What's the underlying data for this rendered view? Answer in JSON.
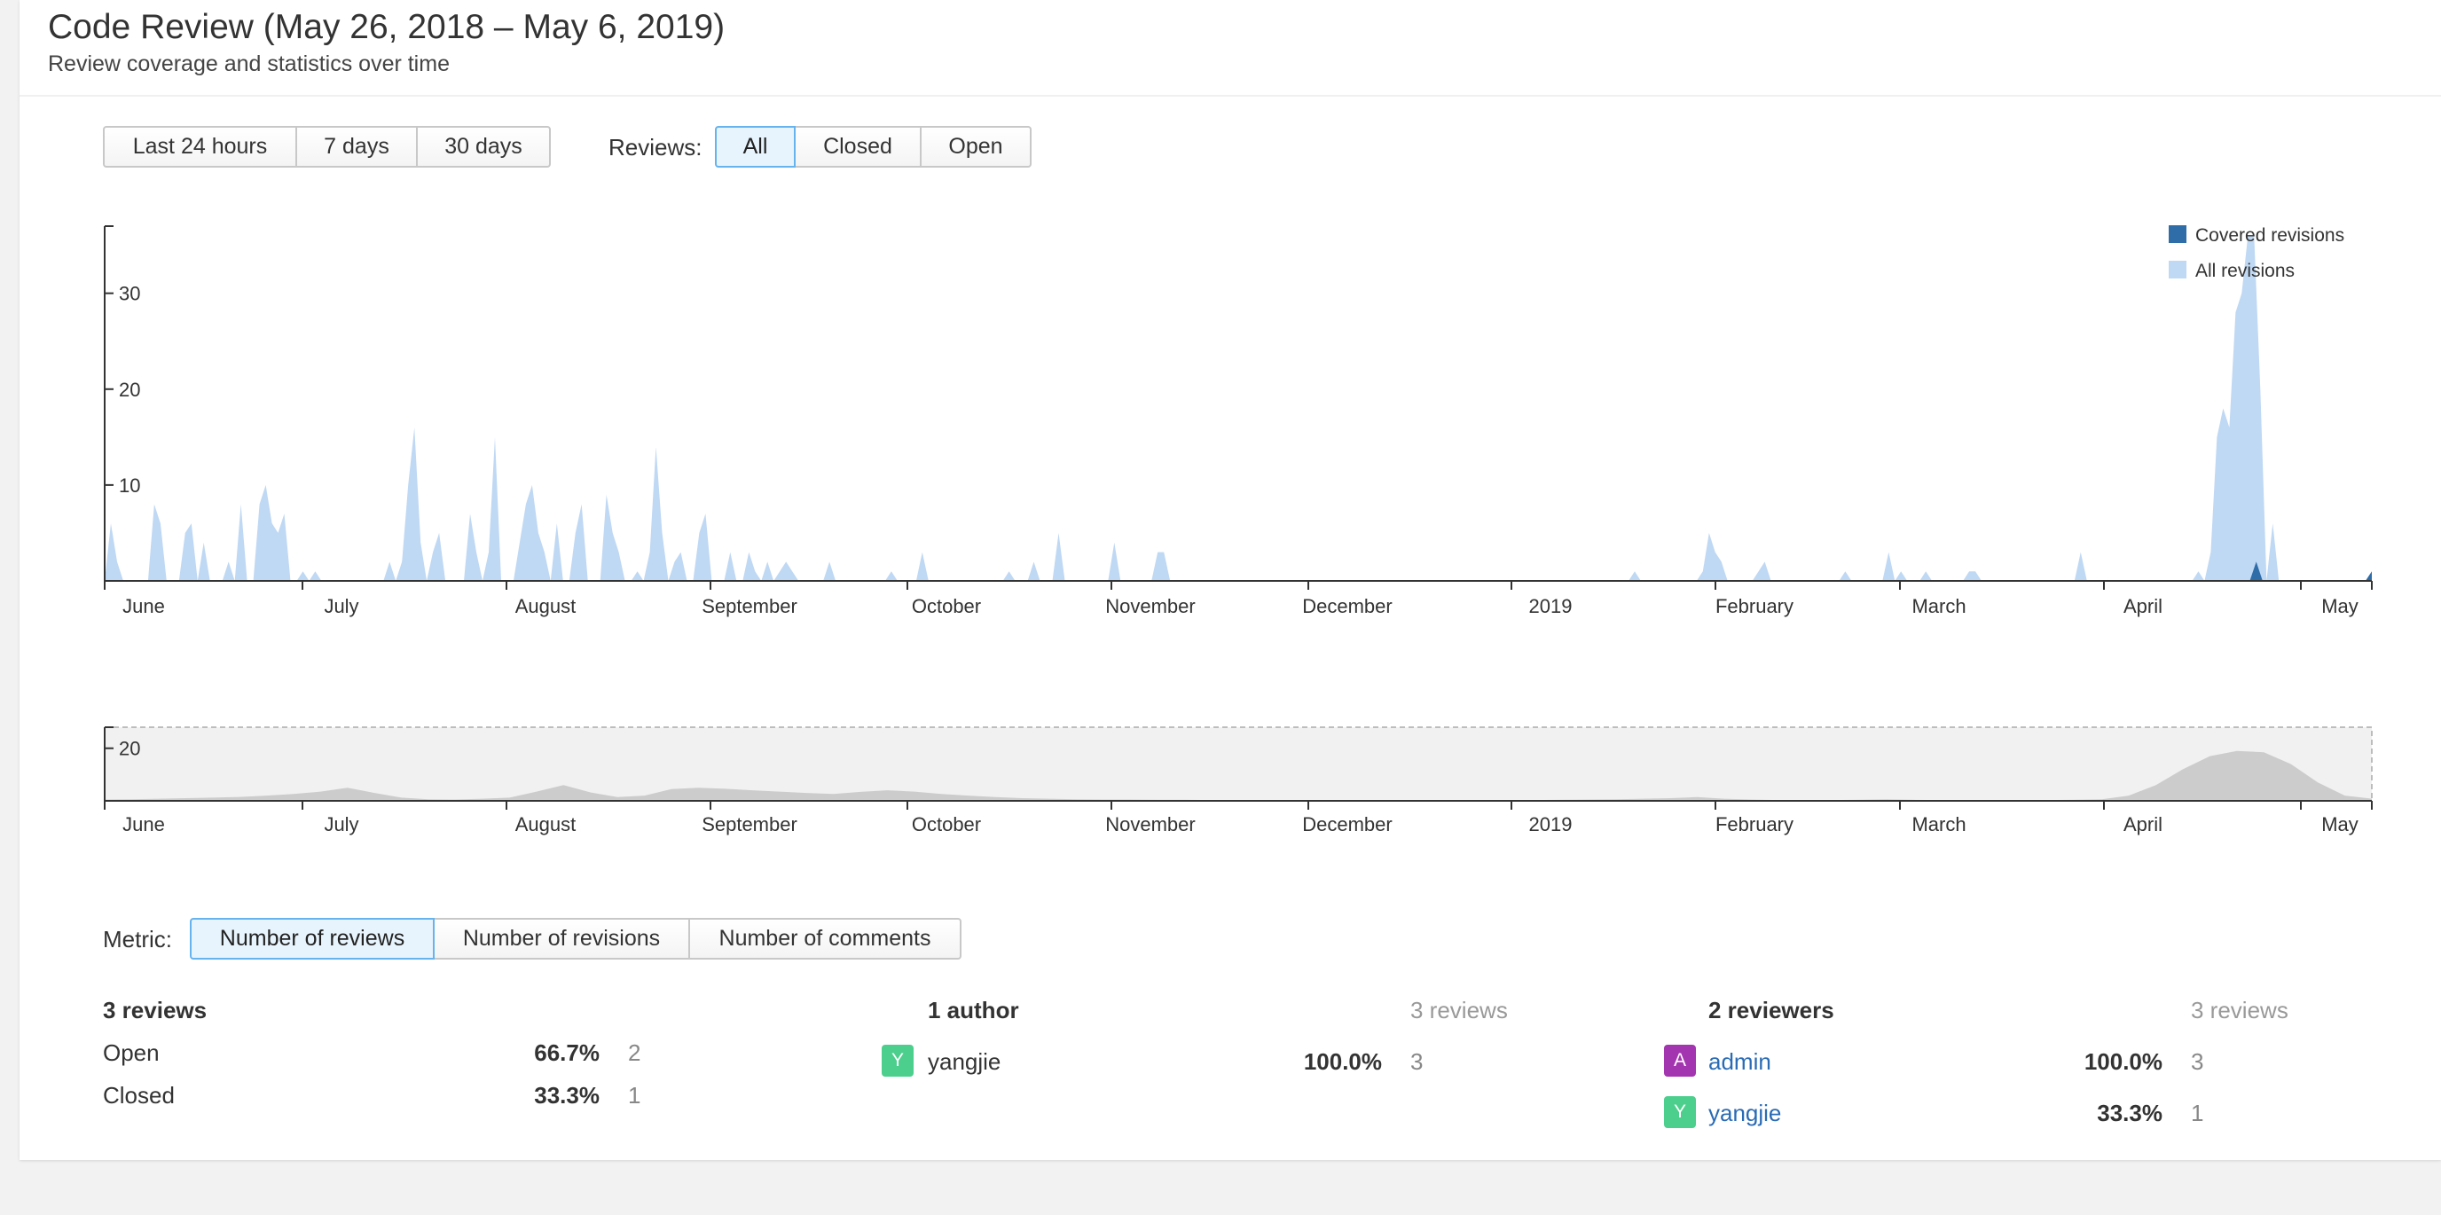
{
  "page": {
    "title": "Code Review (May 26, 2018 – May 6, 2019)",
    "subtitle": "Review coverage and statistics over time"
  },
  "range_buttons": [
    "Last 24 hours",
    "7 days",
    "30 days"
  ],
  "reviews_filter": {
    "label": "Reviews:",
    "options": [
      "All",
      "Closed",
      "Open"
    ],
    "selected": "All"
  },
  "metric": {
    "label": "Metric:",
    "options": [
      "Number of reviews",
      "Number of revisions",
      "Number of comments"
    ],
    "selected": "Number of reviews"
  },
  "colors": {
    "covered": "#2f6da8",
    "all": "#bfd8f3",
    "overview": "#cccccc",
    "avatar_a": "#a335b0",
    "avatar_y": "#4ccf8d"
  },
  "chart_data": [
    {
      "type": "area",
      "legend": [
        "Covered revisions",
        "All revisions"
      ],
      "legend_position": "top-right",
      "x_ticks": [
        "June",
        "July",
        "August",
        "September",
        "October",
        "November",
        "December",
        "2019",
        "February",
        "March",
        "April",
        "May"
      ],
      "y_ticks": [
        10,
        20,
        30
      ],
      "ylim": [
        0,
        37
      ],
      "series": [
        {
          "name": "All revisions",
          "values": [
            0,
            6,
            2,
            0,
            0,
            0,
            0,
            0,
            8,
            6,
            0,
            0,
            0,
            5,
            6,
            0,
            4,
            0,
            0,
            0,
            2,
            0,
            8,
            0,
            0,
            8,
            10,
            6,
            5,
            7,
            0,
            0,
            1,
            0,
            1,
            0,
            0,
            0,
            0,
            0,
            0,
            0,
            0,
            0,
            0,
            0,
            2,
            0,
            2,
            10,
            16,
            4,
            0,
            3,
            5,
            0,
            0,
            0,
            0,
            7,
            3,
            0,
            3,
            15,
            0,
            0,
            0,
            4,
            8,
            10,
            5,
            3,
            0,
            6,
            0,
            0,
            5,
            8,
            0,
            0,
            0,
            9,
            5,
            3,
            0,
            0,
            1,
            0,
            3,
            14,
            5,
            0,
            2,
            3,
            0,
            0,
            5,
            7,
            0,
            0,
            0,
            3,
            0,
            0,
            3,
            1,
            0,
            2,
            0,
            1,
            2,
            1,
            0,
            0,
            0,
            0,
            0,
            2,
            0,
            0,
            0,
            0,
            0,
            0,
            0,
            0,
            0,
            1,
            0,
            0,
            0,
            0,
            3,
            0,
            0,
            0,
            0,
            0,
            0,
            0,
            0,
            0,
            0,
            0,
            0,
            0,
            1,
            0,
            0,
            0,
            2,
            0,
            0,
            0,
            5,
            0,
            0,
            0,
            0,
            0,
            0,
            0,
            0,
            4,
            0,
            0,
            0,
            0,
            0,
            0,
            3,
            3,
            0,
            0,
            0,
            0,
            0,
            0,
            0,
            0,
            0,
            0,
            0,
            0,
            0,
            0,
            0,
            0,
            0,
            0,
            0,
            0,
            0,
            0,
            0,
            0,
            0,
            0,
            0,
            0,
            0,
            0,
            0,
            0,
            0,
            0,
            0,
            0,
            0,
            0,
            0,
            0,
            0,
            0,
            0,
            0,
            0,
            0,
            0,
            0,
            0,
            0,
            0,
            0,
            0,
            0,
            0,
            0,
            0,
            0,
            0,
            0,
            0,
            0,
            0,
            0,
            0,
            0,
            0,
            0,
            0,
            0,
            0,
            0,
            0,
            0,
            0,
            1,
            0,
            0,
            0,
            0,
            0,
            0,
            0,
            0,
            0,
            0,
            1,
            5,
            3,
            2,
            0,
            0,
            0,
            0,
            0,
            1,
            2,
            0,
            0,
            0,
            0,
            0,
            0,
            0,
            0,
            0,
            0,
            0,
            0,
            1,
            0,
            0,
            0,
            0,
            0,
            0,
            3,
            0,
            1,
            0,
            0,
            0,
            1,
            0,
            0,
            0,
            0,
            0,
            0,
            1,
            1,
            0,
            0,
            0,
            0,
            0,
            0,
            0,
            0,
            0,
            0,
            0,
            0,
            0,
            0,
            0,
            0,
            3,
            0,
            0,
            0,
            0,
            0,
            0,
            0,
            0,
            0,
            0,
            0,
            0,
            0,
            0,
            0,
            0,
            0,
            0,
            1,
            0,
            3,
            15,
            18,
            16,
            28,
            30,
            36,
            36,
            20,
            0,
            6,
            0,
            0,
            0,
            0,
            0,
            0,
            0,
            0,
            0,
            0,
            0,
            0,
            0,
            0,
            0,
            1
          ],
          "color": "#bfd8f3"
        },
        {
          "name": "Covered revisions",
          "values": [
            0,
            0,
            0,
            0,
            0,
            0,
            0,
            0,
            0,
            0,
            0,
            0,
            0,
            0,
            0,
            0,
            0,
            0,
            0,
            0,
            0,
            0,
            0,
            0,
            0,
            0,
            0,
            0,
            0,
            0,
            0,
            0,
            0,
            0,
            0,
            0,
            0,
            0,
            0,
            0,
            0,
            0,
            0,
            0,
            0,
            0,
            0,
            0,
            0,
            0,
            0,
            0,
            0,
            0,
            0,
            0,
            0,
            0,
            0,
            0,
            0,
            0,
            0,
            0,
            0,
            0,
            0,
            0,
            0,
            0,
            0,
            0,
            0,
            0,
            0,
            0,
            0,
            0,
            0,
            0,
            0,
            0,
            0,
            0,
            0,
            0,
            0,
            0,
            0,
            0,
            0,
            0,
            0,
            0,
            0,
            0,
            0,
            0,
            0,
            0,
            0,
            0,
            0,
            0,
            0,
            0,
            0,
            0,
            0,
            0,
            0,
            0,
            0,
            0,
            0,
            0,
            0,
            0,
            0,
            0,
            0,
            0,
            0,
            0,
            0,
            0,
            0,
            0,
            0,
            0,
            0,
            0,
            0,
            0,
            0,
            0,
            0,
            0,
            0,
            0,
            0,
            0,
            0,
            0,
            0,
            0,
            0,
            0,
            0,
            0,
            0,
            0,
            0,
            0,
            0,
            0,
            0,
            0,
            0,
            0,
            0,
            0,
            0,
            0,
            0,
            0,
            0,
            0,
            0,
            0,
            0,
            0,
            0,
            0,
            0,
            0,
            0,
            0,
            0,
            0,
            0,
            0,
            0,
            0,
            0,
            0,
            0,
            0,
            0,
            0,
            0,
            0,
            0,
            0,
            0,
            0,
            0,
            0,
            0,
            0,
            0,
            0,
            0,
            0,
            0,
            0,
            0,
            0,
            0,
            0,
            0,
            0,
            0,
            0,
            0,
            0,
            0,
            0,
            0,
            0,
            0,
            0,
            0,
            0,
            0,
            0,
            0,
            0,
            0,
            0,
            0,
            0,
            0,
            0,
            0,
            0,
            0,
            0,
            0,
            0,
            0,
            0,
            0,
            0,
            0,
            0,
            0,
            0,
            0,
            0,
            0,
            0,
            0,
            0,
            0,
            0,
            0,
            0,
            0,
            0,
            0,
            0,
            0,
            0,
            0,
            0,
            0,
            0,
            0,
            0,
            0,
            0,
            0,
            0,
            0,
            0,
            0,
            0,
            0,
            0,
            0,
            0,
            0,
            0,
            0,
            0,
            0,
            0,
            0,
            0,
            0,
            0,
            0,
            0,
            0,
            0,
            0,
            0,
            0,
            0,
            0,
            0,
            0,
            0,
            0,
            0,
            0,
            0,
            0,
            0,
            0,
            0,
            0,
            0,
            0,
            0,
            0,
            0,
            0,
            0,
            0,
            0,
            0,
            0,
            0,
            0,
            0,
            0,
            0,
            0,
            0,
            0,
            0,
            0,
            0,
            2,
            0,
            0,
            0,
            0,
            0,
            0,
            0,
            0,
            0,
            0,
            0,
            0,
            0,
            0,
            0,
            0,
            0,
            1
          ],
          "color": "#2f6da8"
        }
      ]
    },
    {
      "type": "area",
      "x_ticks": [
        "June",
        "July",
        "August",
        "September",
        "October",
        "November",
        "December",
        "2019",
        "February",
        "March",
        "April",
        "May"
      ],
      "y_ticks": [
        20
      ],
      "ylim": [
        0,
        28
      ],
      "series": [
        {
          "values": [
            0.5,
            0.6,
            0.8,
            1,
            1.2,
            1.5,
            2,
            2.6,
            3.5,
            5,
            3,
            1.2,
            0.6,
            0.5,
            0.8,
            1.2,
            3.5,
            6,
            3.2,
            1.4,
            2,
            4.5,
            5,
            4.6,
            4,
            3.5,
            3,
            2.6,
            3.4,
            4,
            3.5,
            2.6,
            2,
            1.4,
            1,
            0.8,
            0.6,
            0.5,
            0.5,
            0.4,
            0.4,
            0.3,
            0.3,
            0.3,
            0.3,
            0.2,
            0.2,
            0.2,
            0.2,
            0.2,
            0.2,
            0.2,
            0.2,
            0.3,
            0.4,
            0.5,
            0.6,
            0.8,
            1,
            1.4,
            0.8,
            0.5,
            0.3,
            0.3,
            0.3,
            0.4,
            0.6,
            0.4,
            0.3,
            0.3,
            0.3,
            0.3,
            0.3,
            0.4,
            0.6,
            2,
            6,
            12,
            17,
            19,
            18.5,
            14,
            7,
            2,
            0.8
          ],
          "color": "#cccccc"
        }
      ]
    }
  ],
  "stats": {
    "reviews": {
      "header": "3 reviews",
      "rows": [
        {
          "label": "Open",
          "pct": "66.7%",
          "count": "2"
        },
        {
          "label": "Closed",
          "pct": "33.3%",
          "count": "1"
        }
      ]
    },
    "authors": {
      "header": "1 author",
      "total": "3 reviews",
      "rows": [
        {
          "avatar": "Y",
          "name": "yangjie",
          "pct": "100.0%",
          "count": "3"
        }
      ]
    },
    "reviewers": {
      "header": "2 reviewers",
      "total": "3 reviews",
      "rows": [
        {
          "avatar": "A",
          "name": "admin",
          "pct": "100.0%",
          "count": "3"
        },
        {
          "avatar": "Y",
          "name": "yangjie",
          "pct": "33.3%",
          "count": "1"
        }
      ]
    }
  }
}
